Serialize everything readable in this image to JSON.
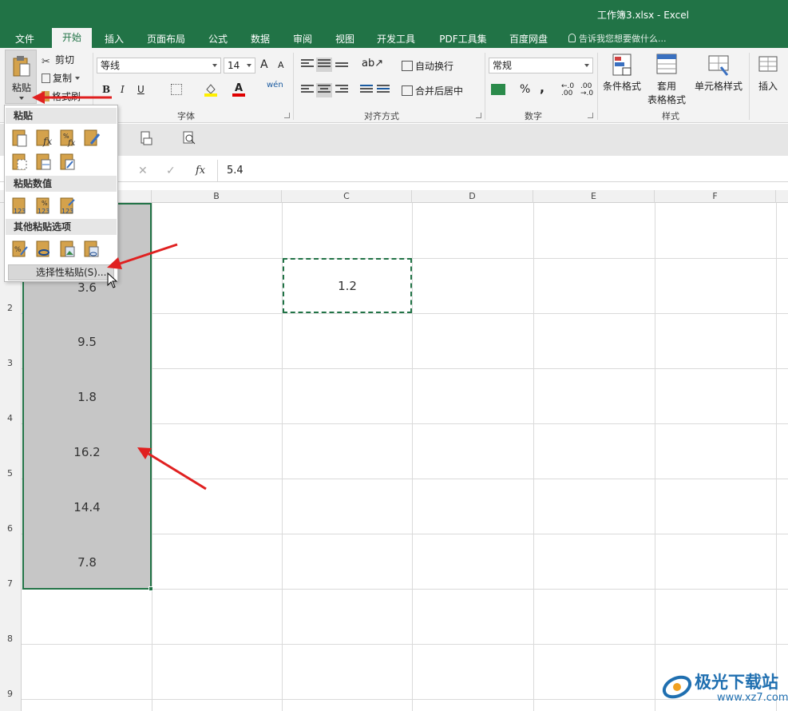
{
  "app": {
    "title": "工作簿3.xlsx - Excel"
  },
  "tabs": [
    {
      "label": "文件"
    },
    {
      "label": "开始"
    },
    {
      "label": "插入"
    },
    {
      "label": "页面布局"
    },
    {
      "label": "公式"
    },
    {
      "label": "数据"
    },
    {
      "label": "审阅"
    },
    {
      "label": "视图"
    },
    {
      "label": "开发工具"
    },
    {
      "label": "PDF工具集"
    },
    {
      "label": "百度网盘"
    }
  ],
  "tell_me": "告诉我您想要做什么...",
  "clipboard": {
    "paste": "粘贴",
    "cut": "剪切",
    "copy": "复制",
    "format_painter": "格式刷"
  },
  "font": {
    "name": "等线",
    "size": "14",
    "group_label": "字体",
    "bold": "B",
    "italic": "I",
    "underline": "U",
    "phonetic": "wén",
    "font_color_glyph": "A",
    "grow": "A",
    "shrink": "A"
  },
  "alignment": {
    "wrap": "自动换行",
    "merge": "合并后居中",
    "group_label": "对齐方式"
  },
  "number": {
    "format": "常规",
    "group_label": "数字",
    "percent": "%",
    "comma": ","
  },
  "styles": {
    "conditional": "条件格式",
    "table_format": "套用",
    "table_format2": "表格格式",
    "cell_styles": "单元格样式",
    "group_label": "样式"
  },
  "cells": {
    "insert": "插入"
  },
  "formula_bar": {
    "cancel": "✕",
    "enter": "✓",
    "fx": "fx",
    "value": "5.4"
  },
  "columns": [
    "B",
    "C",
    "D",
    "E",
    "F"
  ],
  "rows": [
    "2",
    "3",
    "4",
    "5",
    "6",
    "7",
    "8",
    "9"
  ],
  "cells_a": [
    "3.6",
    "9.5",
    "1.8",
    "16.2",
    "14.4",
    "7.8"
  ],
  "copied_cell": "1.2",
  "paste_menu": {
    "section_paste": "粘贴",
    "section_values": "粘贴数值",
    "section_other": "其他粘贴选项",
    "paste_special": "选择性粘贴(S)..."
  },
  "watermark": {
    "brand": "极光下载站",
    "url": "www.xz7.com"
  },
  "colors": {
    "accent": "#217346",
    "arrow": "#e02020"
  }
}
